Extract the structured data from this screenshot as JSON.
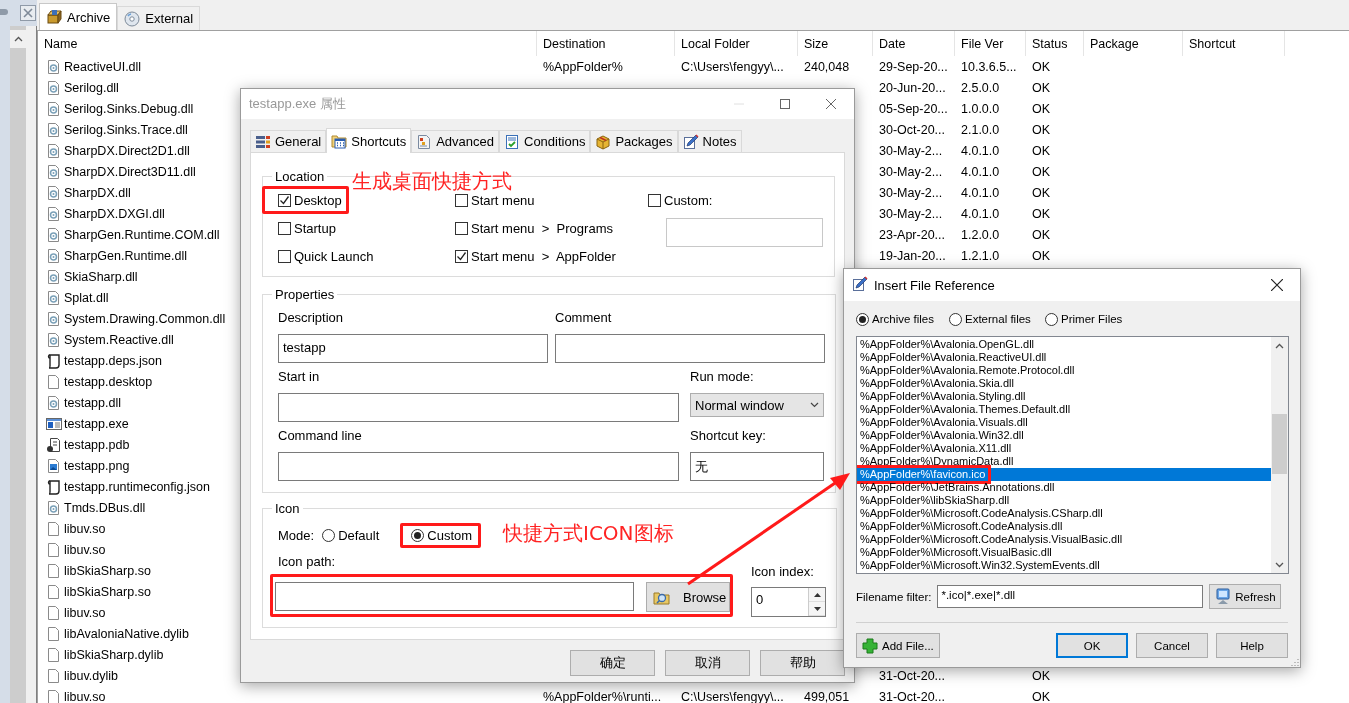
{
  "main_tabs": [
    {
      "label": "Archive",
      "kind": "archive",
      "selected": true
    },
    {
      "label": "External",
      "kind": "disc",
      "selected": false
    }
  ],
  "table": {
    "columns": [
      "Name",
      "Destination",
      "Local Folder",
      "Size",
      "Date",
      "File Ver",
      "Status",
      "Package",
      "Shortcut"
    ],
    "rows": [
      {
        "kind": "dll",
        "name": "ReactiveUI.dll",
        "destination": "%AppFolder%",
        "local_folder": "C:\\Users\\fengyy\\...",
        "size": "240,048",
        "date": "29-Sep-20...",
        "file_ver": "10.3.6.5...",
        "status": "OK"
      },
      {
        "kind": "dll",
        "name": "Serilog.dll",
        "date": "20-Jun-20...",
        "file_ver": "2.5.0.0",
        "status": "OK"
      },
      {
        "kind": "dll",
        "name": "Serilog.Sinks.Debug.dll",
        "date": "05-Sep-20...",
        "file_ver": "1.0.0.0",
        "status": "OK"
      },
      {
        "kind": "dll",
        "name": "Serilog.Sinks.Trace.dll",
        "date": "30-Oct-20...",
        "file_ver": "2.1.0.0",
        "status": "OK"
      },
      {
        "kind": "dll",
        "name": "SharpDX.Direct2D1.dll",
        "date": "30-May-2...",
        "file_ver": "4.0.1.0",
        "status": "OK"
      },
      {
        "kind": "dll",
        "name": "SharpDX.Direct3D11.dll",
        "date": "30-May-2...",
        "file_ver": "4.0.1.0",
        "status": "OK"
      },
      {
        "kind": "dll",
        "name": "SharpDX.dll",
        "date": "30-May-2...",
        "file_ver": "4.0.1.0",
        "status": "OK"
      },
      {
        "kind": "dll",
        "name": "SharpDX.DXGI.dll",
        "date": "30-May-2...",
        "file_ver": "4.0.1.0",
        "status": "OK"
      },
      {
        "kind": "dll",
        "name": "SharpGen.Runtime.COM.dll",
        "date": "23-Apr-20...",
        "file_ver": "1.2.0.0",
        "status": "OK"
      },
      {
        "kind": "dll",
        "name": "SharpGen.Runtime.dll",
        "date": "19-Jan-20...",
        "file_ver": "1.2.1.0",
        "status": "OK"
      },
      {
        "kind": "dll",
        "name": "SkiaSharp.dll"
      },
      {
        "kind": "dll",
        "name": "Splat.dll"
      },
      {
        "kind": "dll",
        "name": "System.Drawing.Common.dll"
      },
      {
        "kind": "dll",
        "name": "System.Reactive.dll"
      },
      {
        "kind": "json",
        "name": "testapp.deps.json"
      },
      {
        "kind": "file",
        "name": "testapp.desktop"
      },
      {
        "kind": "dll",
        "name": "testapp.dll"
      },
      {
        "kind": "exe",
        "name": "testapp.exe"
      },
      {
        "kind": "pdb",
        "name": "testapp.pdb"
      },
      {
        "kind": "png",
        "name": "testapp.png"
      },
      {
        "kind": "json",
        "name": "testapp.runtimeconfig.json"
      },
      {
        "kind": "dll",
        "name": "Tmds.DBus.dll"
      },
      {
        "kind": "file",
        "name": "libuv.so"
      },
      {
        "kind": "file",
        "name": "libuv.so"
      },
      {
        "kind": "file",
        "name": "libSkiaSharp.so"
      },
      {
        "kind": "file",
        "name": "libSkiaSharp.so"
      },
      {
        "kind": "file",
        "name": "libuv.so"
      },
      {
        "kind": "file",
        "name": "libAvaloniaNative.dylib"
      },
      {
        "kind": "file",
        "name": "libSkiaSharp.dylib"
      },
      {
        "kind": "file",
        "name": "libuv.dylib",
        "date": "31-Oct-20...",
        "status": "OK"
      },
      {
        "kind": "file",
        "name": "libuv.so",
        "destination": "%AppFolder%\\runti...",
        "local_folder": "C:\\Users\\fengyy\\...",
        "size": "499,051",
        "date": "31-Oct-20...",
        "status": "OK"
      }
    ]
  },
  "properties_dialog": {
    "title": "testapp.exe 属性",
    "active": false,
    "tabs": [
      {
        "label": "General",
        "kind": "general",
        "selected": false
      },
      {
        "label": "Shortcuts",
        "kind": "shortcuts",
        "selected": true
      },
      {
        "label": "Advanced",
        "kind": "advanced",
        "selected": false
      },
      {
        "label": "Conditions",
        "kind": "conditions",
        "selected": false
      },
      {
        "label": "Packages",
        "kind": "packages",
        "selected": false
      },
      {
        "label": "Notes",
        "kind": "notes",
        "selected": false
      }
    ],
    "location": {
      "legend": "Location",
      "options": [
        {
          "label": "Desktop",
          "checked": true
        },
        {
          "label": "Startup",
          "checked": false
        },
        {
          "label": "Quick Launch",
          "checked": false
        },
        {
          "label": "Start menu",
          "checked": false
        },
        {
          "label": "Start menu  >  Programs",
          "checked": false
        },
        {
          "label": "Start menu  >  AppFolder",
          "checked": true
        }
      ],
      "custom": {
        "label": "Custom:",
        "checked": false
      }
    },
    "properties": {
      "legend": "Properties",
      "description": {
        "label": "Description",
        "value": "testapp"
      },
      "comment": {
        "label": "Comment"
      },
      "start_in": {
        "label": "Start in"
      },
      "run_mode": {
        "label": "Run mode:",
        "value": "Normal window"
      },
      "command_line": {
        "label": "Command line"
      },
      "shortcut_key": {
        "label": "Shortcut key:",
        "value": "无"
      }
    },
    "icon": {
      "legend": "Icon",
      "mode_label": "Mode:",
      "modes": [
        {
          "label": "Default",
          "selected": false
        },
        {
          "label": "Custom",
          "selected": true
        }
      ],
      "path_label": "Icon path:",
      "browse": "Browse",
      "index_label": "Icon index:",
      "index_value": "0"
    },
    "buttons": [
      "确定",
      "取消",
      "帮助"
    ]
  },
  "insert_dialog": {
    "title": "Insert File Reference",
    "sources": [
      {
        "label": "Archive files",
        "selected": true
      },
      {
        "label": "External files",
        "selected": false
      },
      {
        "label": "Primer Files",
        "selected": false
      }
    ],
    "files": [
      {
        "path": "%AppFolder%\\Avalonia.OpenGL.dll",
        "selected": false
      },
      {
        "path": "%AppFolder%\\Avalonia.ReactiveUI.dll",
        "selected": false
      },
      {
        "path": "%AppFolder%\\Avalonia.Remote.Protocol.dll",
        "selected": false
      },
      {
        "path": "%AppFolder%\\Avalonia.Skia.dll",
        "selected": false
      },
      {
        "path": "%AppFolder%\\Avalonia.Styling.dll",
        "selected": false
      },
      {
        "path": "%AppFolder%\\Avalonia.Themes.Default.dll",
        "selected": false
      },
      {
        "path": "%AppFolder%\\Avalonia.Visuals.dll",
        "selected": false
      },
      {
        "path": "%AppFolder%\\Avalonia.Win32.dll",
        "selected": false
      },
      {
        "path": "%AppFolder%\\Avalonia.X11.dll",
        "selected": false
      },
      {
        "path": "%AppFolder%\\DynamicData.dll",
        "selected": false
      },
      {
        "path": "%AppFolder%\\favicon.ico",
        "selected": true
      },
      {
        "path": "%AppFolder%\\JetBrains.Annotations.dll",
        "selected": false
      },
      {
        "path": "%AppFolder%\\libSkiaSharp.dll",
        "selected": false
      },
      {
        "path": "%AppFolder%\\Microsoft.CodeAnalysis.CSharp.dll",
        "selected": false
      },
      {
        "path": "%AppFolder%\\Microsoft.CodeAnalysis.dll",
        "selected": false
      },
      {
        "path": "%AppFolder%\\Microsoft.CodeAnalysis.VisualBasic.dll",
        "selected": false
      },
      {
        "path": "%AppFolder%\\Microsoft.VisualBasic.dll",
        "selected": false
      },
      {
        "path": "%AppFolder%\\Microsoft.Win32.SystemEvents.dll",
        "selected": false
      }
    ],
    "filter": {
      "label": "Filename filter:",
      "value": "*.ico|*.exe|*.dll"
    },
    "refresh": "Refresh",
    "add_file": "Add File...",
    "buttons": [
      {
        "label": "OK",
        "default": true
      },
      {
        "label": "Cancel",
        "default": false
      },
      {
        "label": "Help",
        "default": false
      }
    ]
  },
  "annotations": [
    "生成桌面快捷方式",
    "快捷方式ICON图标"
  ]
}
